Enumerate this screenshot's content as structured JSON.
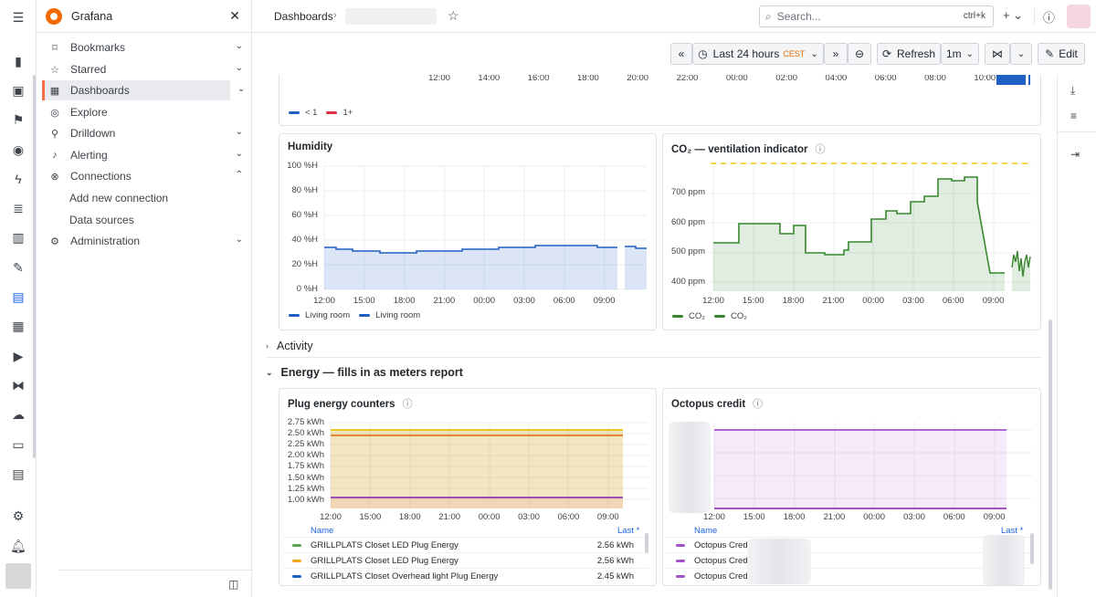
{
  "app": {
    "name": "Grafana",
    "close_icon": "close-icon"
  },
  "rail": {
    "icons": [
      "menu-icon",
      "mobile-icon",
      "inbox-icon",
      "flag-icon",
      "rocket-icon",
      "bolt-icon",
      "list-icon",
      "chart-bar-icon",
      "wrench-icon",
      "dashboards-icon",
      "storefront-icon",
      "media-icon",
      "vscode-icon",
      "cloud-icon",
      "terminal-icon",
      "clipboard-icon",
      "gear-icon",
      "bell-icon"
    ]
  },
  "nav": {
    "items": [
      {
        "label": "Bookmarks",
        "icon": "bookmark-icon",
        "expandable": true
      },
      {
        "label": "Starred",
        "icon": "star-icon",
        "expandable": true
      },
      {
        "label": "Dashboards",
        "icon": "apps-icon",
        "expandable": true,
        "active": true
      },
      {
        "label": "Explore",
        "icon": "compass-icon",
        "expandable": false
      },
      {
        "label": "Drilldown",
        "icon": "drilldown-icon",
        "expandable": true
      },
      {
        "label": "Alerting",
        "icon": "bell-icon",
        "expandable": true
      },
      {
        "label": "Connections",
        "icon": "link-icon",
        "expandable": true,
        "expanded": true
      },
      {
        "label": "Administration",
        "icon": "cog-icon",
        "expandable": true
      }
    ],
    "connections_children": [
      "Add new connection",
      "Data sources"
    ]
  },
  "topbar": {
    "breadcrumb": "Dashboards",
    "search_placeholder": "Search...",
    "search_shortcut": "ctrl+k"
  },
  "toolbar": {
    "time_range": "Last 24 hours",
    "timezone": "CEST",
    "refresh_label": "Refresh",
    "refresh_interval": "1m",
    "edit_label": "Edit"
  },
  "top_panel": {
    "x_ticks": [
      "12:00",
      "14:00",
      "16:00",
      "18:00",
      "20:00",
      "22:00",
      "00:00",
      "02:00",
      "04:00",
      "06:00",
      "08:00",
      "10:00"
    ],
    "legend": [
      {
        "label": "< 1",
        "color": "#1f60c4"
      },
      {
        "label": "1+",
        "color": "#e02f44"
      }
    ]
  },
  "humidity": {
    "title": "Humidity",
    "y_ticks": [
      "100 %H",
      "80 %H",
      "60 %H",
      "40 %H",
      "20 %H",
      "0 %H"
    ],
    "x_ticks": [
      "12:00",
      "15:00",
      "18:00",
      "21:00",
      "00:00",
      "03:00",
      "06:00",
      "09:00"
    ],
    "legend": [
      {
        "label": "Living room",
        "color": "#1f60c4"
      },
      {
        "label": "Living room",
        "color": "#1f60c4"
      }
    ],
    "color": "#1f60c4"
  },
  "co2": {
    "title": "CO₂ — ventilation indicator",
    "y_ticks": [
      "700 ppm",
      "600 ppm",
      "500 ppm",
      "400 ppm"
    ],
    "x_ticks": [
      "12:00",
      "15:00",
      "18:00",
      "21:00",
      "00:00",
      "03:00",
      "06:00",
      "09:00"
    ],
    "legend": [
      {
        "label": "CO₂",
        "color": "#37872d"
      },
      {
        "label": "CO₂",
        "color": "#37872d"
      }
    ],
    "color": "#37872d",
    "threshold_color": "#f2cc0c"
  },
  "sections": {
    "activity": "Activity",
    "energy": "Energy — fills in as meters report"
  },
  "plug": {
    "title": "Plug energy counters",
    "y_ticks": [
      "2.75 kWh",
      "2.50 kWh",
      "2.25 kWh",
      "2.00 kWh",
      "1.75 kWh",
      "1.50 kWh",
      "1.25 kWh",
      "1.00 kWh"
    ],
    "x_ticks": [
      "12:00",
      "15:00",
      "18:00",
      "21:00",
      "00:00",
      "03:00",
      "06:00",
      "09:00"
    ],
    "table_headers": {
      "name": "Name",
      "last": "Last *"
    },
    "rows": [
      {
        "name": "GRILLPLATS Closet LED Plug Energy",
        "value": "2.56 kWh",
        "color": "#56a64b"
      },
      {
        "name": "GRILLPLATS Closet LED Plug Energy",
        "value": "2.56 kWh",
        "color": "#f2a61f"
      },
      {
        "name": "GRILLPLATS Closet Overhead light Plug Energy",
        "value": "2.45 kWh",
        "color": "#1f60c4"
      }
    ]
  },
  "octopus": {
    "title": "Octopus credit",
    "x_ticks": [
      "12:00",
      "15:00",
      "18:00",
      "21:00",
      "00:00",
      "03:00",
      "06:00",
      "09:00"
    ],
    "table_headers": {
      "name": "Name",
      "last": "Last *"
    },
    "rows": [
      {
        "name": "Octopus Credi",
        "color": "#a352cc"
      },
      {
        "name": "Octopus Credi",
        "color": "#a352cc"
      },
      {
        "name": "Octopus Credi",
        "color": "#a352cc"
      }
    ]
  }
}
